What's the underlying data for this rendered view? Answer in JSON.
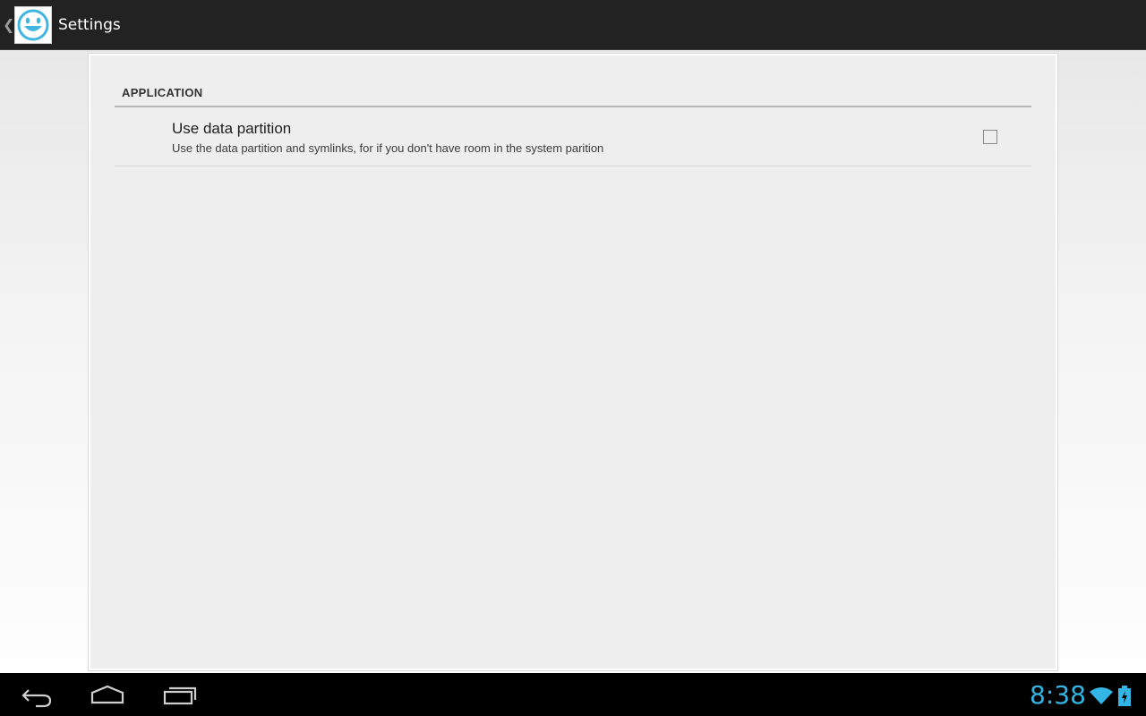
{
  "action_bar": {
    "title": "Settings",
    "app_icon": "smiley-face-icon",
    "up_icon": "chevron-left-icon"
  },
  "preferences": {
    "category": "APPLICATION",
    "items": [
      {
        "title": "Use data partition",
        "summary": "Use the data partition and symlinks, for if you don't have room in the system parition",
        "checked": false
      }
    ]
  },
  "nav_bar": {
    "back_icon": "back-arrow-icon",
    "home_icon": "home-icon",
    "recents_icon": "recent-apps-icon"
  },
  "status_bar": {
    "time": "8:38",
    "wifi_icon": "wifi-icon",
    "battery_icon": "battery-charging-icon",
    "accent_color": "#33b5e5"
  },
  "colors": {
    "action_bar_bg": "#222222",
    "card_bg": "#eeeeee",
    "nav_bar_bg": "#000000"
  }
}
